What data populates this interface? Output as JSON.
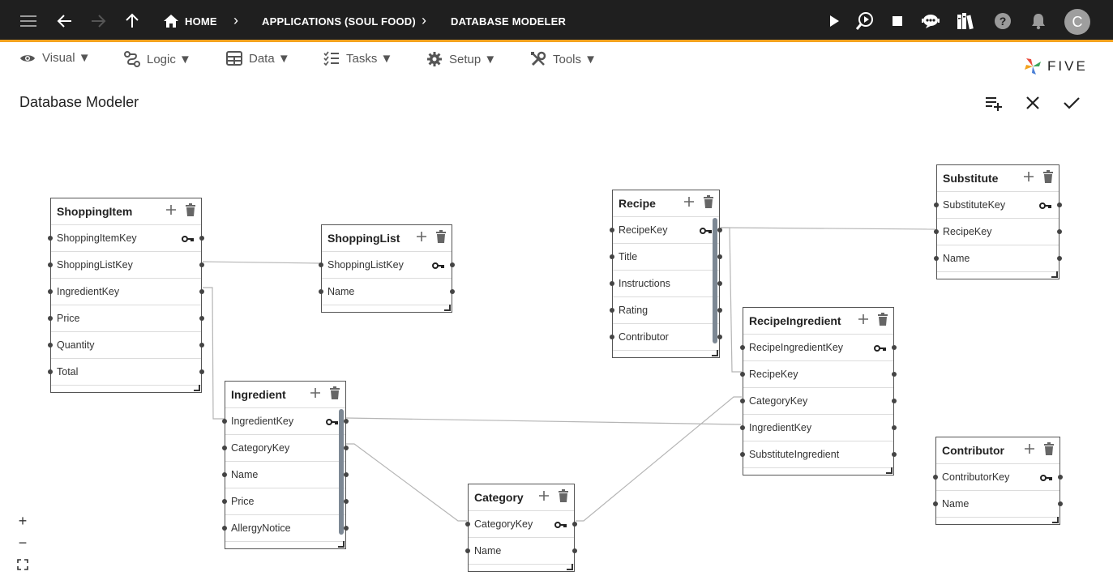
{
  "header": {
    "crumbs": [
      "HOME",
      "APPLICATIONS (SOUL FOOD)",
      "DATABASE MODELER"
    ],
    "avatar_letter": "C",
    "accent": "#f3a31f"
  },
  "menu": [
    {
      "label": "Visual ▼",
      "icon": "eye-icon"
    },
    {
      "label": "Logic ▼",
      "icon": "logic-icon"
    },
    {
      "label": "Data ▼",
      "icon": "table-icon"
    },
    {
      "label": "Tasks ▼",
      "icon": "tasks-icon"
    },
    {
      "label": "Setup ▼",
      "icon": "gear-icon"
    },
    {
      "label": "Tools ▼",
      "icon": "tools-icon"
    }
  ],
  "logo_text": "FIVE",
  "page_title": "Database Modeler",
  "tables": {
    "shoppingitem": {
      "name": "ShoppingItem",
      "fields": [
        "ShoppingItemKey",
        "ShoppingListKey",
        "IngredientKey",
        "Price",
        "Quantity",
        "Total"
      ]
    },
    "shoppinglist": {
      "name": "ShoppingList",
      "fields": [
        "ShoppingListKey",
        "Name"
      ]
    },
    "recipe": {
      "name": "Recipe",
      "fields": [
        "RecipeKey",
        "Title",
        "Instructions",
        "Rating",
        "Contributor"
      ]
    },
    "substitute": {
      "name": "Substitute",
      "fields": [
        "SubstituteKey",
        "RecipeKey",
        "Name"
      ]
    },
    "recipeingredient": {
      "name": "RecipeIngredient",
      "fields": [
        "RecipeIngredientKey",
        "RecipeKey",
        "CategoryKey",
        "IngredientKey",
        "SubstituteIngredient"
      ]
    },
    "ingredient": {
      "name": "Ingredient",
      "fields": [
        "IngredientKey",
        "CategoryKey",
        "Name",
        "Price",
        "AllergyNotice"
      ]
    },
    "category": {
      "name": "Category",
      "fields": [
        "CategoryKey",
        "Name"
      ]
    },
    "contributor": {
      "name": "Contributor",
      "fields": [
        "ContributorKey",
        "Name"
      ]
    }
  },
  "zoom": {
    "plus": "+",
    "minus": "−"
  }
}
